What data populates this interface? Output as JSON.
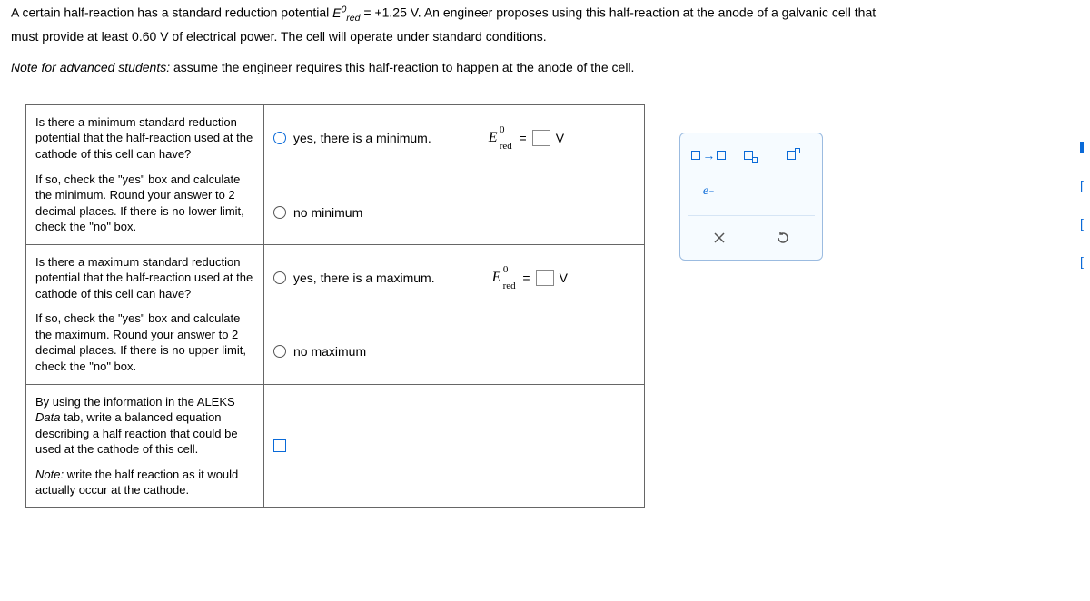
{
  "problem": {
    "line1_a": "A certain half-reaction has a standard reduction potential ",
    "line1_b": " = +1.25 V. An engineer proposes using this half-reaction at the anode of a galvanic cell that",
    "line2": "must provide at least 0.60 V of electrical power. The cell will operate under standard conditions.",
    "line3_a": "Note for advanced students:",
    "line3_b": " assume the engineer requires this half-reaction to happen at the anode of the cell."
  },
  "q1": {
    "p1": "Is there a minimum standard reduction potential that the half-reaction used at the cathode of this cell can have?",
    "p2": "If so, check the \"yes\" box and calculate the minimum. Round your answer to 2 decimal places. If there is no lower limit, check the \"no\" box.",
    "opt_yes": "yes, there is a minimum.",
    "opt_no": "no minimum",
    "unit": "V"
  },
  "q2": {
    "p1": "Is there a maximum standard reduction potential that the half-reaction used at the cathode of this cell can have?",
    "p2": "If so, check the \"yes\" box and calculate the maximum. Round your answer to 2 decimal places. If there is no upper limit, check the \"no\" box.",
    "opt_yes": "yes, there is a maximum.",
    "opt_no": "no maximum",
    "unit": "V"
  },
  "q3": {
    "p1": "By using the information in the ALEKS Data tab, write a balanced equation describing a half reaction that could be used at the cathode of this cell.",
    "p2": "Note: write the half reaction as it would actually occur at the cathode."
  },
  "ered_label": {
    "E": "E",
    "zero": "0",
    "red": "red"
  },
  "equals": "="
}
